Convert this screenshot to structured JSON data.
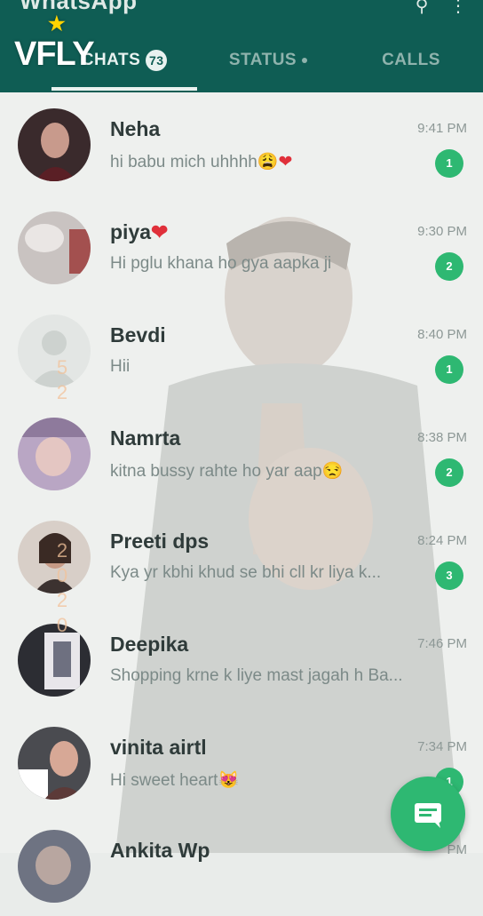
{
  "app": {
    "title": "WhatsApp",
    "watermark_logo": "VFLY"
  },
  "tabs": [
    {
      "label": "CHATS",
      "badge": "73"
    },
    {
      "label": "STATUS"
    },
    {
      "label": "CALLS"
    }
  ],
  "chats": [
    {
      "name": "Neha",
      "preview": "hi babu mich uhhhh",
      "preview_emoji": "😩❤",
      "time": "9:41 PM",
      "unread": "1"
    },
    {
      "name": "piya",
      "name_emoji": "❤",
      "preview": "Hi pglu khana ho gya aapka ji",
      "time": "9:30 PM",
      "unread": "2"
    },
    {
      "name": "Bevdi",
      "preview": "Hii",
      "time": "8:40 PM",
      "unread": "1"
    },
    {
      "name": "Namrta",
      "preview": "kitna bussy rahte ho yar aap",
      "preview_emoji": "😒",
      "time": "8:38 PM",
      "unread": "2"
    },
    {
      "name": "Preeti dps",
      "preview": "Kya yr kbhi khud se bhi cll kr liya k...",
      "time": "8:24 PM",
      "unread": "3"
    },
    {
      "name": "Deepika",
      "preview": "Shopping krne k liye mast jagah h Ba...",
      "time": "7:46 PM"
    },
    {
      "name": "vinita airtl",
      "preview": "Hi sweet heart",
      "preview_emoji": "😻",
      "time": "7:34 PM",
      "unread": "1"
    },
    {
      "name": "Ankita Wp",
      "time": "PM"
    }
  ],
  "side_watermark_digits": [
    "5",
    "2",
    "",
    "2",
    "0",
    "2",
    "0"
  ],
  "icons": {
    "new_chat": "message-icon"
  },
  "colors": {
    "header": "#0f5d54",
    "accent": "#2eb872"
  }
}
